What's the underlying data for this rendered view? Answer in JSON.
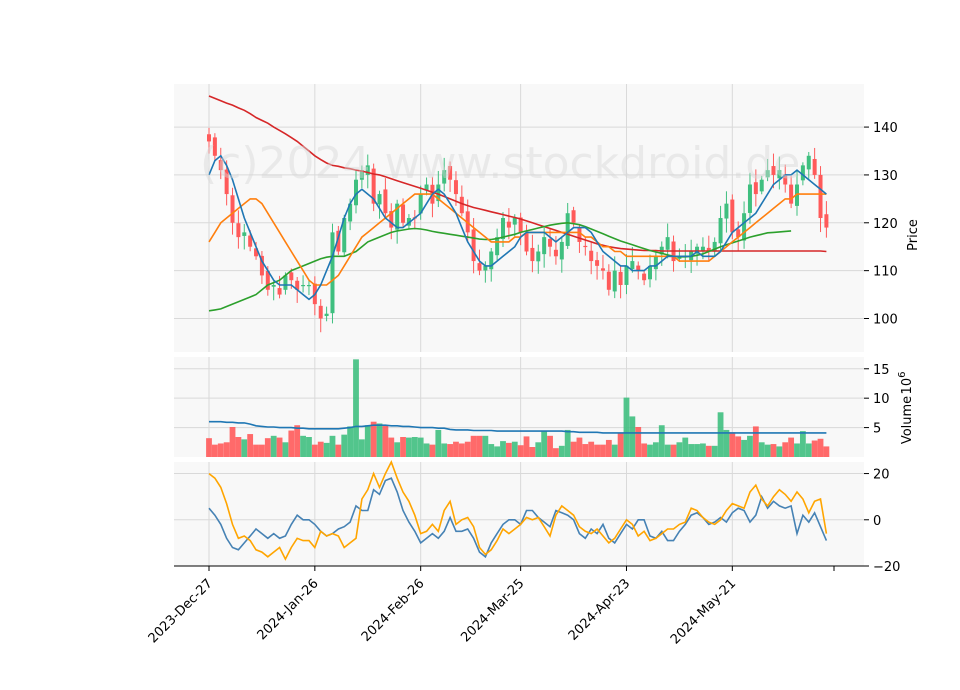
{
  "watermark": "(c)2024 www.stockdroid.de",
  "colors": {
    "up": "#3fbf7f",
    "down": "#ff5a5a",
    "panel_bg": "#f8f8f8",
    "grid": "#d9d9d9",
    "ma_blue": "#1f77b4",
    "ma_orange": "#ff7f0e",
    "ma_green": "#2ca02c",
    "ma_red": "#d62728",
    "osc_blue": "#4682b4",
    "osc_orange": "#ffa500"
  },
  "chart_data": {
    "type": "candlestick",
    "x_ticks": [
      "2023-Dec-27",
      "2024-Jan-26",
      "2024-Feb-26",
      "2024-Mar-25",
      "2024-Apr-23",
      "2024-May-21"
    ],
    "price_panel": {
      "ylabel": "Price",
      "ylim": [
        93,
        149
      ],
      "yticks": [
        100,
        110,
        120,
        130,
        140
      ],
      "close": [
        137,
        134,
        131,
        126,
        120,
        117,
        118,
        115,
        113,
        109,
        106,
        107,
        105,
        109,
        108,
        106,
        107,
        107,
        103,
        100,
        101,
        118,
        114,
        121,
        124,
        129,
        131,
        132,
        124,
        126,
        122,
        119,
        124,
        120,
        121,
        121,
        126,
        128,
        124,
        128,
        131,
        129,
        126,
        122,
        118,
        112,
        110,
        111,
        114,
        117,
        121,
        119,
        121,
        118,
        114,
        112,
        114,
        117,
        115,
        113,
        116,
        122,
        120,
        116,
        115,
        112,
        111,
        110,
        106,
        110,
        107,
        111,
        112,
        110,
        108,
        111,
        113,
        115,
        117,
        112,
        113,
        113,
        114,
        115,
        115,
        114,
        116,
        121,
        124,
        118,
        117,
        122,
        128,
        126,
        129,
        131,
        130,
        131,
        128,
        124,
        128,
        132,
        134,
        130,
        121,
        119
      ],
      "ma_blue": [
        130,
        133,
        134,
        132,
        129,
        125,
        121,
        118,
        115,
        112,
        110,
        108,
        107,
        107,
        107,
        106,
        105,
        104,
        105,
        107,
        110,
        113,
        117,
        121,
        124,
        126,
        127,
        126,
        125,
        123,
        121,
        120,
        119,
        119,
        120,
        121,
        122,
        124,
        126,
        127,
        126,
        124,
        122,
        119,
        116,
        114,
        112,
        111,
        111,
        112,
        113,
        114,
        115,
        117,
        118,
        118,
        118,
        118,
        117,
        116,
        117,
        118,
        119,
        119,
        119,
        118,
        116,
        114,
        113,
        112,
        111,
        111,
        110,
        110,
        110,
        111,
        111,
        112,
        113,
        113,
        113,
        113,
        113,
        114,
        113,
        113,
        113,
        114,
        116,
        118,
        119,
        120,
        121,
        122,
        124,
        126,
        128,
        129,
        130,
        130,
        131,
        130,
        129,
        128,
        127,
        126
      ],
      "ma_orange": [
        116,
        118,
        120,
        121,
        122,
        123,
        124,
        125,
        125,
        124,
        122,
        120,
        118,
        116,
        114,
        112,
        110,
        108,
        107,
        107,
        107,
        108,
        109,
        111,
        113,
        115,
        117,
        118,
        119,
        120,
        121,
        122,
        123,
        124,
        125,
        126,
        126,
        126,
        126,
        125,
        124,
        123,
        122,
        121,
        120,
        119,
        118,
        117,
        116,
        116,
        116,
        116,
        117,
        117,
        118,
        118,
        118,
        118,
        118,
        118,
        118,
        118,
        118,
        118,
        117,
        117,
        116,
        115,
        115,
        114,
        114,
        113,
        113,
        113,
        113,
        113,
        113,
        113,
        113,
        113,
        112,
        112,
        112,
        112,
        112,
        112,
        113,
        114,
        115,
        116,
        117,
        118,
        119,
        120,
        121,
        122,
        123,
        124,
        125,
        125,
        126,
        126,
        126,
        126,
        126,
        126
      ],
      "ma_green": [
        101.6,
        101.8,
        102,
        102.5,
        103,
        103.5,
        104,
        104.5,
        105,
        106,
        107,
        107.5,
        108,
        109,
        110,
        110.5,
        111,
        111.5,
        112,
        112.5,
        112.8,
        113,
        113,
        113,
        113.5,
        114,
        115,
        116,
        116.5,
        117,
        117.5,
        118,
        118.3,
        118.5,
        118.7,
        118.8,
        118.7,
        118.5,
        118.2,
        118,
        117.8,
        117.6,
        117.4,
        117.2,
        117,
        116.8,
        116.6,
        116.5,
        116.5,
        116.7,
        117,
        117.3,
        117.6,
        118,
        118.3,
        118.6,
        118.9,
        119.2,
        119.5,
        119.7,
        119.9,
        120,
        119.8,
        119.6,
        119.2,
        118.7,
        118.2,
        117.7,
        117.2,
        116.7,
        116.2,
        115.8,
        115.4,
        115,
        114.6,
        114.2,
        113.9,
        113.6,
        113.3,
        113,
        112.9,
        112.9,
        113,
        113.2,
        113.5,
        114,
        114.5,
        115,
        115.4,
        115.8,
        116.2,
        116.6,
        117,
        117.3,
        117.6,
        117.9,
        118,
        118.1,
        118.2,
        118.3
      ],
      "ma_red": [
        146.5,
        146,
        145.5,
        145,
        144.6,
        144,
        143.5,
        142.8,
        142,
        141.4,
        140.8,
        140,
        139.3,
        138.6,
        137.8,
        137,
        136,
        135,
        134,
        133.2,
        132.5,
        132,
        131.8,
        131.5,
        131.3,
        131,
        130.8,
        130.5,
        130.2,
        130,
        129.6,
        129.2,
        128.8,
        128.4,
        128,
        127.6,
        127.2,
        126.8,
        126.4,
        126,
        125.5,
        125,
        124.5,
        124,
        123.6,
        123.2,
        122.9,
        122.6,
        122.3,
        122,
        121.7,
        121.4,
        121.1,
        120.8,
        120.4,
        120,
        119.6,
        119.2,
        118.8,
        118.4,
        118,
        117.6,
        117.2,
        116.8,
        116.4,
        116,
        115.6,
        115.3,
        115,
        114.8,
        114.6,
        114.5,
        114.4,
        114.3,
        114.2,
        114.2,
        114.2,
        114.1,
        114.1,
        114.1,
        114.1,
        114.1,
        114.1,
        114.1,
        114.1,
        114.1,
        114.1,
        114.1,
        114.1,
        114.1,
        114.1,
        114.1,
        114.1,
        114.1,
        114.1,
        114.1,
        114.1,
        114.1,
        114.1,
        114.1,
        114.1,
        114.1,
        114.1,
        114.1,
        114.1,
        114
      ]
    },
    "volume_panel": {
      "ylabel": "Volume",
      "multiplier_label": "10",
      "multiplier_exp": "6",
      "ylim": [
        0,
        17
      ],
      "yticks": [
        5,
        10,
        15
      ],
      "values": [
        3.2,
        2.1,
        2.3,
        2.5,
        5.1,
        3.4,
        3.0,
        3.9,
        2.1,
        2.1,
        3.2,
        3.6,
        3.3,
        2.5,
        4.5,
        5.4,
        3.6,
        3.4,
        2.1,
        2.6,
        2.4,
        3.6,
        2.1,
        3.8,
        5.2,
        16.6,
        3.0,
        5.4,
        6.0,
        5.7,
        5.4,
        3.3,
        2.5,
        3.4,
        3.3,
        3.4,
        3.3,
        2.3,
        2.1,
        4.6,
        2.3,
        2.2,
        2.6,
        2.3,
        2.6,
        3.6,
        3.6,
        3.6,
        2.2,
        1.8,
        2.7,
        2.4,
        2.6,
        2.0,
        3.5,
        1.7,
        2.5,
        4.5,
        3.6,
        1.5,
        1.9,
        4.6,
        2.6,
        3.3,
        2.2,
        2.6,
        2.1,
        2.1,
        2.9,
        2.1,
        4.0,
        10.1,
        6.9,
        5.1,
        2.3,
        2.1,
        2.5,
        5.4,
        2.1,
        2.1,
        2.5,
        3.3,
        2.2,
        2.2,
        2.3,
        1.9,
        1.9,
        7.6,
        4.6,
        4.2,
        3.5,
        2.9,
        3.6,
        5.2,
        2.5,
        2.1,
        2.2,
        1.8,
        2.5,
        3.3,
        2.3,
        4.4,
        2.3,
        2.8,
        3.1,
        1.8
      ],
      "ma": [
        6.0,
        6.0,
        6.0,
        5.9,
        5.9,
        5.8,
        5.8,
        5.6,
        5.3,
        5.2,
        5.1,
        5.1,
        5.0,
        5.0,
        5.0,
        4.9,
        4.9,
        4.8,
        4.8,
        4.8,
        4.8,
        4.8,
        4.8,
        4.9,
        5.0,
        5.2,
        5.2,
        5.3,
        5.4,
        5.4,
        5.4,
        5.3,
        5.3,
        5.2,
        5.2,
        5.1,
        5.0,
        5.0,
        5.0,
        4.9,
        4.9,
        4.7,
        4.6,
        4.6,
        4.6,
        4.5,
        4.5,
        4.5,
        4.5,
        4.4,
        4.4,
        4.4,
        4.4,
        4.4,
        4.4,
        4.4,
        4.4,
        4.4,
        4.4,
        4.4,
        4.4,
        4.3,
        4.3,
        4.2,
        4.2,
        4.2,
        4.2,
        4.1,
        4.1,
        4.1,
        4.1,
        4.1,
        4.1,
        4.1,
        4.1,
        4.1,
        4.1,
        4.1,
        4.1,
        4.1,
        4.1,
        4.1,
        4.1,
        4.1,
        4.1,
        4.1,
        4.1,
        4.1,
        4.1,
        4.1,
        4.1,
        4.1,
        4.1,
        4.1,
        4.1,
        4.1,
        4.1,
        4.1,
        4.1,
        4.1,
        4.1,
        4.1,
        4.1,
        4.1,
        4.1,
        4.1
      ]
    },
    "osc_panel": {
      "ylim": [
        -20,
        25
      ],
      "yticks": [
        -20,
        0,
        20
      ],
      "blue": [
        5,
        2,
        -2,
        -8,
        -12,
        -13,
        -10,
        -7,
        -4,
        -6,
        -8,
        -6,
        -8,
        -7,
        -2,
        2,
        0,
        0,
        -2,
        -5,
        -7,
        -6,
        -4,
        -3,
        -1,
        6,
        4,
        4,
        13,
        11,
        17,
        18,
        12,
        4,
        -1,
        -5,
        -10,
        -8,
        -6,
        -8,
        -5,
        1,
        -5,
        -5,
        -4,
        -8,
        -14,
        -16,
        -10,
        -6,
        -2,
        0,
        0,
        -2,
        4,
        4,
        1,
        -1,
        -3,
        4,
        3,
        2,
        0,
        -6,
        -8,
        -4,
        -6,
        -2,
        -8,
        -10,
        -6,
        -2,
        -4,
        0,
        0,
        -7,
        -8,
        -5,
        -9,
        -9,
        -5,
        -2,
        2,
        3,
        1,
        -2,
        -1,
        1,
        -1,
        3,
        5,
        4,
        -1,
        2,
        10,
        5,
        8,
        6,
        5,
        6,
        -6,
        2,
        -1,
        3,
        -3,
        -9
      ],
      "orange": [
        20,
        18,
        14,
        7,
        -2,
        -8,
        -7,
        -9,
        -13,
        -14,
        -16,
        -14,
        -12,
        -17,
        -12,
        -8,
        -9,
        -9,
        -12,
        -5,
        -7,
        -6,
        -7,
        -12,
        -10,
        -8,
        9,
        13,
        20,
        14,
        20,
        25,
        18,
        12,
        8,
        2,
        -6,
        -5,
        -2,
        -5,
        4,
        8,
        -2,
        0,
        1,
        -3,
        -12,
        -15,
        -13,
        -9,
        -4,
        -6,
        -4,
        -2,
        1,
        0,
        1,
        -3,
        -7,
        2,
        6,
        4,
        2,
        -3,
        -5,
        -6,
        -4,
        -7,
        -10,
        -8,
        -4,
        0,
        -2,
        -7,
        -5,
        -9,
        -8,
        -6,
        -4,
        -4,
        -2,
        -1,
        5,
        4,
        1,
        -1,
        -2,
        0,
        4,
        7,
        6,
        5,
        12,
        15,
        9,
        6,
        10,
        13,
        11,
        8,
        12,
        9,
        3,
        8,
        9,
        -6
      ]
    }
  }
}
